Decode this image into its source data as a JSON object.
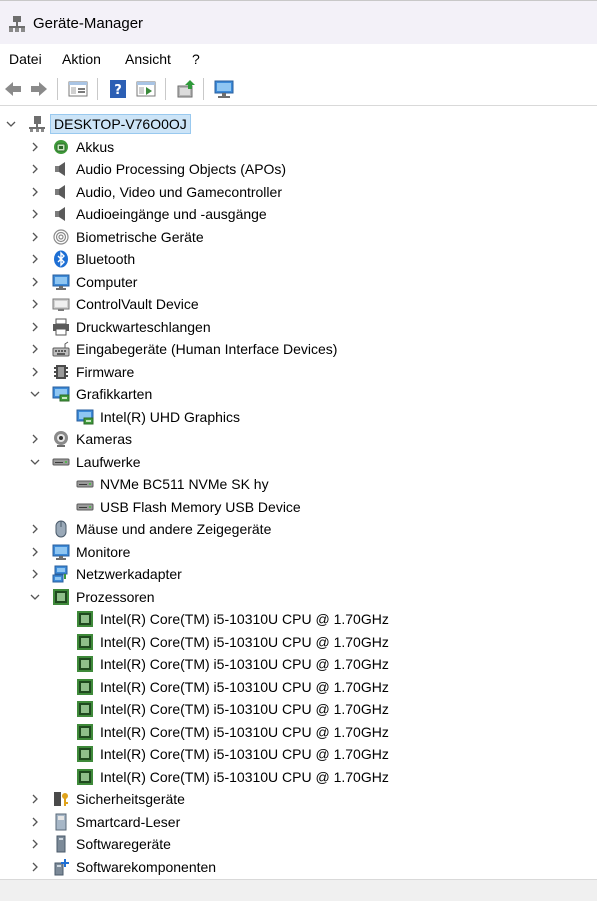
{
  "window": {
    "title": "Geräte-Manager"
  },
  "menu": [
    "Datei",
    "Aktion",
    "Ansicht",
    "?"
  ],
  "toolbar": [
    "back",
    "forward",
    "properties",
    "help",
    "show-hidden",
    "update-driver",
    "scan-hardware"
  ],
  "tree": [
    {
      "label": "DESKTOP-V76O0OJ",
      "level": 0,
      "state": "expanded",
      "icon": "computer-tower-icon",
      "selected": true
    },
    {
      "label": "Akkus",
      "level": 1,
      "state": "collapsed",
      "icon": "battery-icon"
    },
    {
      "label": "Audio Processing Objects (APOs)",
      "level": 1,
      "state": "collapsed",
      "icon": "speaker-icon"
    },
    {
      "label": "Audio, Video und Gamecontroller",
      "level": 1,
      "state": "collapsed",
      "icon": "speaker-icon"
    },
    {
      "label": "Audioeingänge und -ausgänge",
      "level": 1,
      "state": "collapsed",
      "icon": "speaker-icon"
    },
    {
      "label": "Biometrische Geräte",
      "level": 1,
      "state": "collapsed",
      "icon": "fingerprint-icon"
    },
    {
      "label": "Bluetooth",
      "level": 1,
      "state": "collapsed",
      "icon": "bluetooth-icon"
    },
    {
      "label": "Computer",
      "level": 1,
      "state": "collapsed",
      "icon": "monitor-icon"
    },
    {
      "label": "ControlVault Device",
      "level": 1,
      "state": "collapsed",
      "icon": "device-icon"
    },
    {
      "label": "Druckwarteschlangen",
      "level": 1,
      "state": "collapsed",
      "icon": "printer-icon"
    },
    {
      "label": "Eingabegeräte (Human Interface Devices)",
      "level": 1,
      "state": "collapsed",
      "icon": "hid-icon"
    },
    {
      "label": "Firmware",
      "level": 1,
      "state": "collapsed",
      "icon": "firmware-icon"
    },
    {
      "label": "Grafikkarten",
      "level": 1,
      "state": "expanded",
      "icon": "display-adapter-icon"
    },
    {
      "label": "Intel(R) UHD Graphics",
      "level": 2,
      "state": "leaf",
      "icon": "display-adapter-icon"
    },
    {
      "label": "Kameras",
      "level": 1,
      "state": "collapsed",
      "icon": "camera-icon"
    },
    {
      "label": "Laufwerke",
      "level": 1,
      "state": "expanded",
      "icon": "drive-icon"
    },
    {
      "label": "NVMe BC511 NVMe SK hy",
      "level": 2,
      "state": "leaf",
      "icon": "drive-icon"
    },
    {
      "label": "USB Flash Memory USB Device",
      "level": 2,
      "state": "leaf",
      "icon": "drive-icon"
    },
    {
      "label": "Mäuse und andere Zeigegeräte",
      "level": 1,
      "state": "collapsed",
      "icon": "mouse-icon"
    },
    {
      "label": "Monitore",
      "level": 1,
      "state": "collapsed",
      "icon": "monitor-icon"
    },
    {
      "label": "Netzwerkadapter",
      "level": 1,
      "state": "collapsed",
      "icon": "network-icon"
    },
    {
      "label": "Prozessoren",
      "level": 1,
      "state": "expanded",
      "icon": "cpu-icon"
    },
    {
      "label": "Intel(R) Core(TM) i5-10310U CPU @ 1.70GHz",
      "level": 2,
      "state": "leaf",
      "icon": "cpu-icon"
    },
    {
      "label": "Intel(R) Core(TM) i5-10310U CPU @ 1.70GHz",
      "level": 2,
      "state": "leaf",
      "icon": "cpu-icon"
    },
    {
      "label": "Intel(R) Core(TM) i5-10310U CPU @ 1.70GHz",
      "level": 2,
      "state": "leaf",
      "icon": "cpu-icon"
    },
    {
      "label": "Intel(R) Core(TM) i5-10310U CPU @ 1.70GHz",
      "level": 2,
      "state": "leaf",
      "icon": "cpu-icon"
    },
    {
      "label": "Intel(R) Core(TM) i5-10310U CPU @ 1.70GHz",
      "level": 2,
      "state": "leaf",
      "icon": "cpu-icon"
    },
    {
      "label": "Intel(R) Core(TM) i5-10310U CPU @ 1.70GHz",
      "level": 2,
      "state": "leaf",
      "icon": "cpu-icon"
    },
    {
      "label": "Intel(R) Core(TM) i5-10310U CPU @ 1.70GHz",
      "level": 2,
      "state": "leaf",
      "icon": "cpu-icon"
    },
    {
      "label": "Intel(R) Core(TM) i5-10310U CPU @ 1.70GHz",
      "level": 2,
      "state": "leaf",
      "icon": "cpu-icon"
    },
    {
      "label": "Sicherheitsgeräte",
      "level": 1,
      "state": "collapsed",
      "icon": "security-key-icon"
    },
    {
      "label": "Smartcard-Leser",
      "level": 1,
      "state": "collapsed",
      "icon": "smartcard-reader-icon"
    },
    {
      "label": "Softwaregeräte",
      "level": 1,
      "state": "collapsed",
      "icon": "software-device-icon"
    },
    {
      "label": "Softwarekomponenten",
      "level": 1,
      "state": "collapsed",
      "icon": "software-component-icon"
    }
  ],
  "colors": {
    "titlebar": "#f3f1f8",
    "selection": "#cce4f7",
    "selection_border": "#99c9ef",
    "accent": "#0a64c8"
  }
}
